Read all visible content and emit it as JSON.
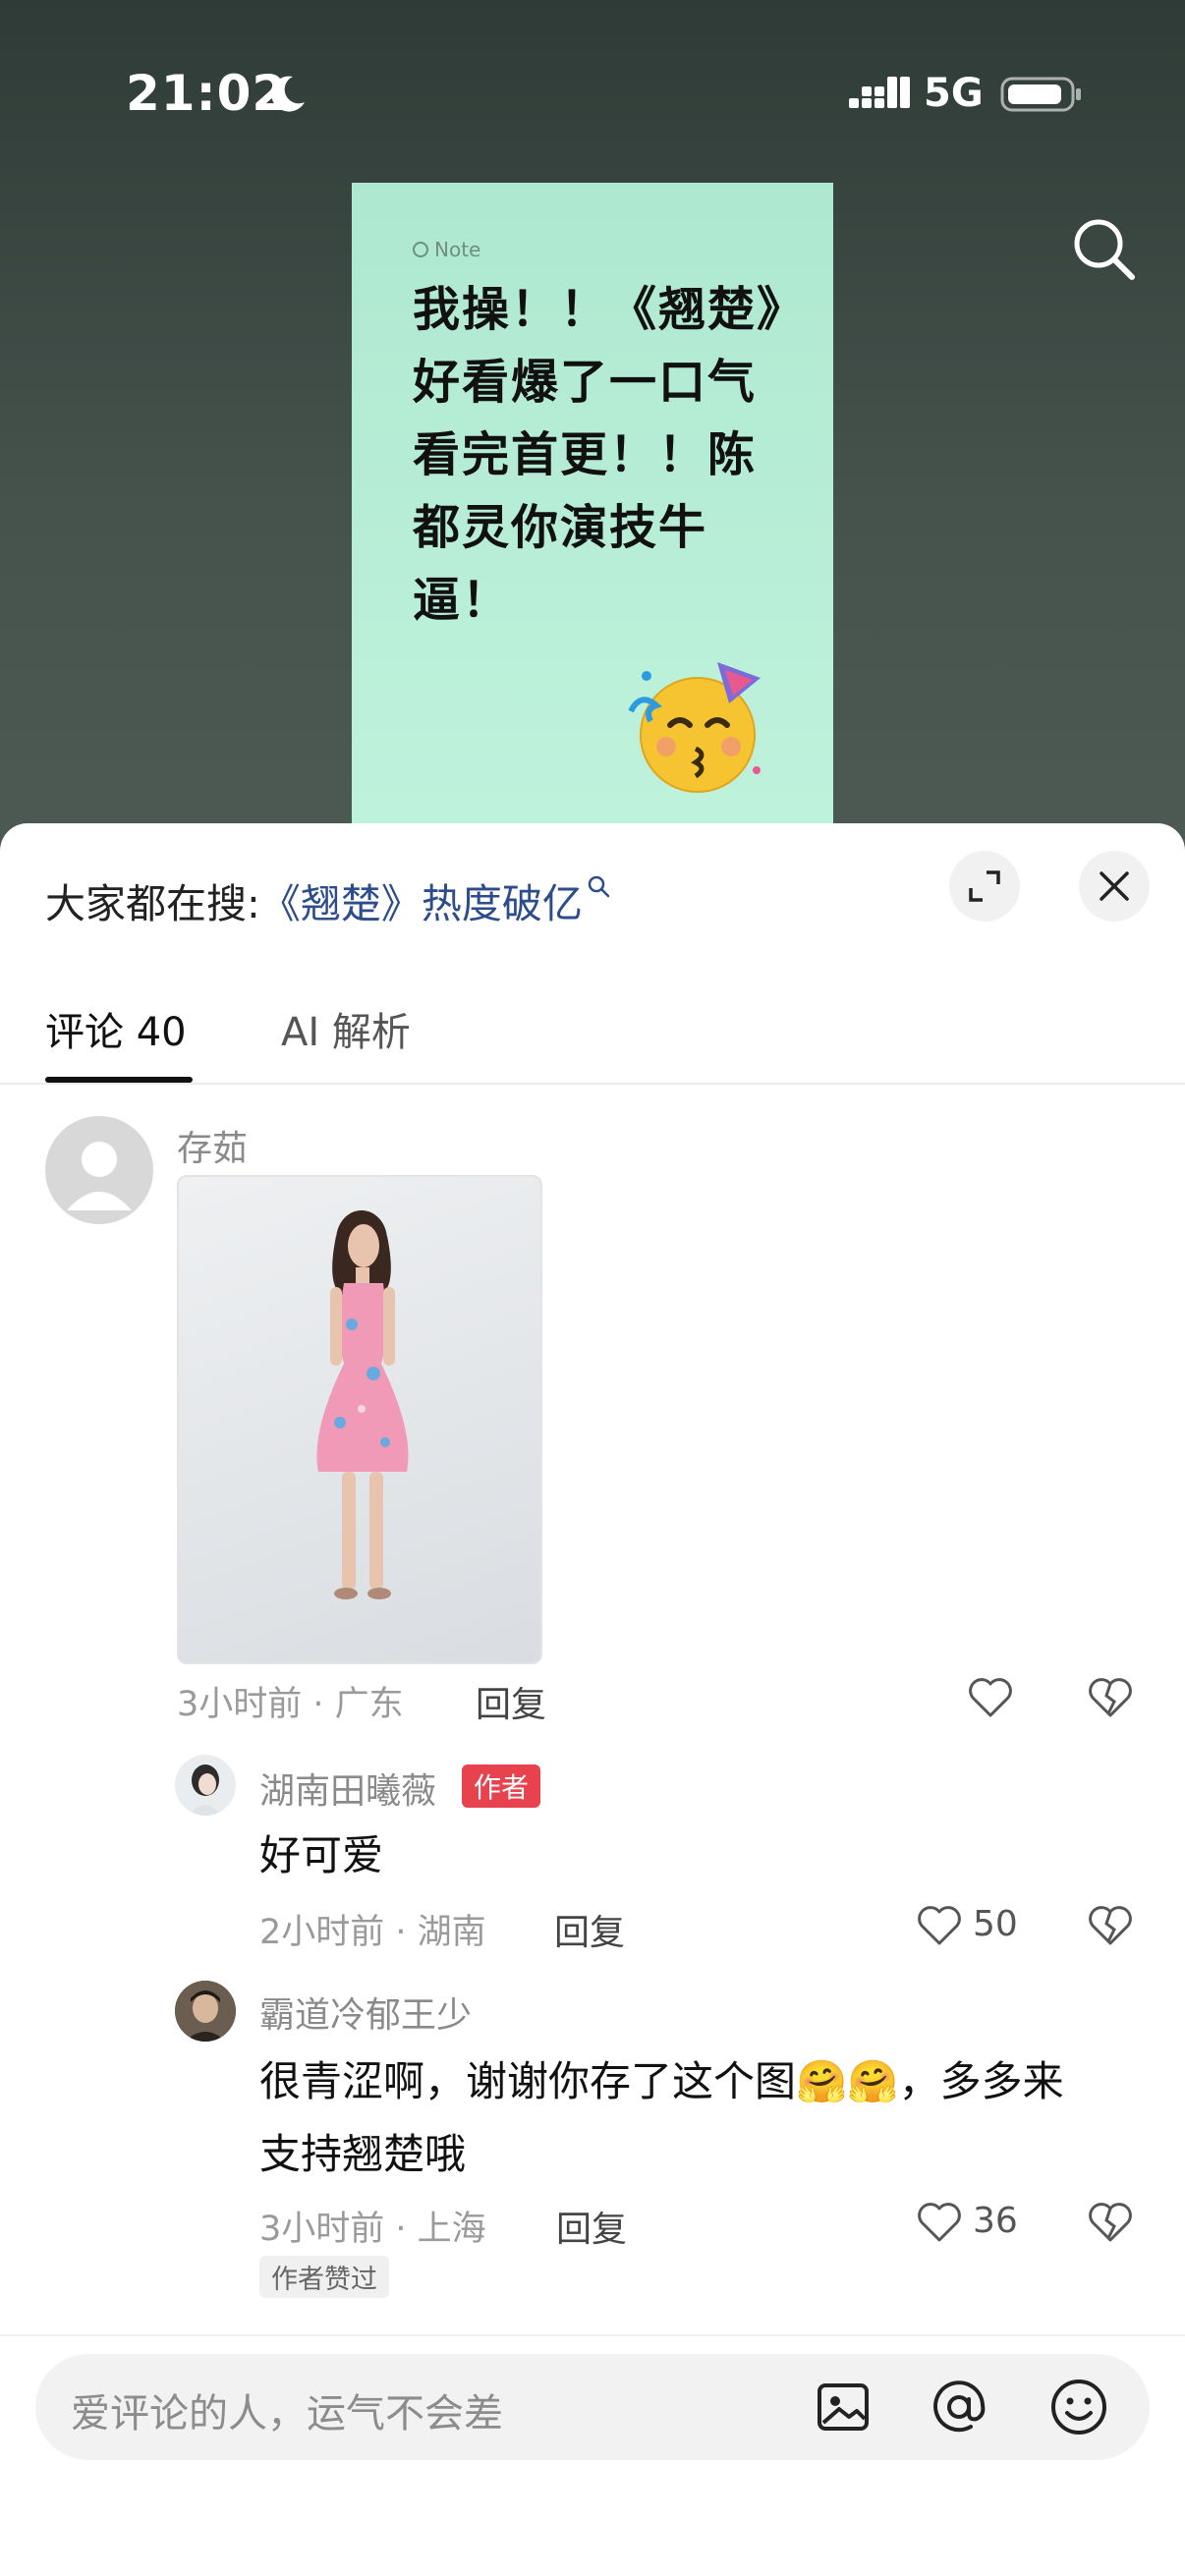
{
  "status_bar": {
    "time": "21:02",
    "network": "5G"
  },
  "note": {
    "tag": "Note",
    "text": "我操！！《翘楚》好看爆了一口气看完首更！！陈都灵你演技牛逼！"
  },
  "search_suggestion": {
    "prefix": "大家都在搜:",
    "query": "《翘楚》热度破亿"
  },
  "tabs": [
    {
      "label": "评论 40",
      "active": true
    },
    {
      "label": "AI 解析",
      "active": false
    }
  ],
  "comments": [
    {
      "user": "存茹",
      "meta": "3小时前 · 广东",
      "reply": "回复",
      "like_count": "",
      "replies": [
        {
          "user": "湖南田曦薇",
          "badge": "作者",
          "text": "好可爱",
          "meta": "2小时前 · 湖南",
          "reply": "回复",
          "like_count": "50"
        },
        {
          "user": "霸道冷郁王少",
          "text_line1": "很青涩啊，谢谢你存了这个图🤗🤗，多多来",
          "text_line2": "支持翘楚哦",
          "meta": "3小时前 · 上海",
          "reply": "回复",
          "like_count": "36",
          "tag": "作者赞过"
        }
      ]
    }
  ],
  "input": {
    "placeholder": "爱评论的人，运气不会差"
  },
  "colors": {
    "accent_red": "#e8424f",
    "link_blue": "#2c4c8c",
    "note_bg": "#b6edd6"
  }
}
